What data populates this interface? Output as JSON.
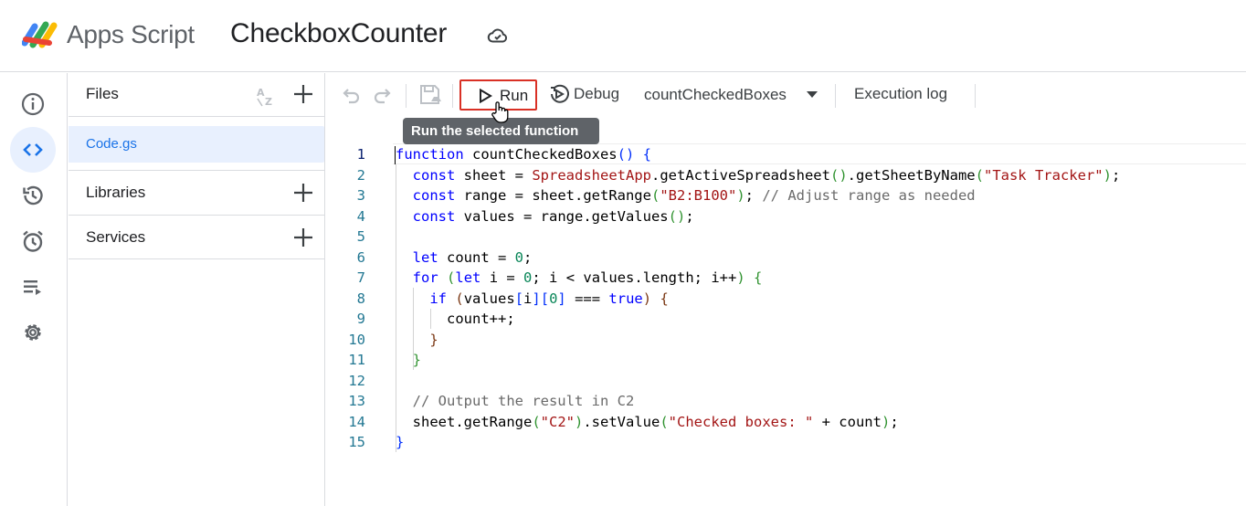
{
  "header": {
    "app_name": "Apps Script",
    "project_title": "CheckboxCounter"
  },
  "rail": {
    "items": [
      "overview",
      "editor",
      "executions",
      "triggers",
      "executions-log",
      "settings"
    ],
    "active": "editor"
  },
  "files_panel": {
    "files_label": "Files",
    "files": [
      "Code.gs"
    ],
    "libraries_label": "Libraries",
    "services_label": "Services"
  },
  "toolbar": {
    "run_label": "Run",
    "debug_label": "Debug",
    "function_name": "countCheckedBoxes",
    "execution_log_label": "Execution log"
  },
  "tooltip": {
    "text": "Run the selected function"
  },
  "editor": {
    "line_numbers": [
      "1",
      "2",
      "3",
      "4",
      "5",
      "6",
      "7",
      "8",
      "9",
      "10",
      "11",
      "12",
      "13",
      "14",
      "15"
    ],
    "code": [
      "function countCheckedBoxes() {",
      "  const sheet = SpreadsheetApp.getActiveSpreadsheet().getSheetByName(\"Task Tracker\");",
      "  const range = sheet.getRange(\"B2:B100\"); // Adjust range as needed",
      "  const values = range.getValues();",
      "",
      "  let count = 0;",
      "  for (let i = 0; i < values.length; i++) {",
      "    if (values[i][0] === true) {",
      "      count++;",
      "    }",
      "  }",
      "",
      "  // Output the result in C2",
      "  sheet.getRange(\"C2\").setValue(\"Checked boxes: \" + count);",
      "}"
    ]
  },
  "colors": {
    "accent": "#1a73e8",
    "active_bg": "#e8f0fe",
    "run_highlight": "#d93025",
    "tooltip_bg": "#5f6368"
  }
}
